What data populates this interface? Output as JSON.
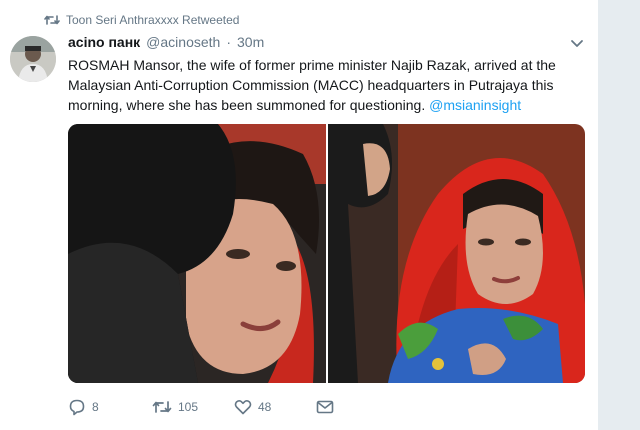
{
  "retweet_banner": {
    "icon": "retweet-icon",
    "text": "Toon Seri Anthraxxxx Retweeted"
  },
  "tweet": {
    "author_name": "acino панк",
    "author_handle": "@acinoseth",
    "separator": "·",
    "timestamp": "30m",
    "text_parts": {
      "body": "ROSMAH Mansor, the wife of former prime minister Najib Razak, arrived at the Malaysian Anti-Corruption Commission (MACC) headquarters in Putrajaya this morning, where she has been summoned for questioning. ",
      "mention": "@msianinsight"
    },
    "media_count": 2
  },
  "actions": {
    "reply_count": "8",
    "retweet_count": "105",
    "like_count": "48"
  },
  "colors": {
    "link": "#1da1f2",
    "secondary_text": "#657786",
    "sidebar": "#e6ecf0"
  }
}
